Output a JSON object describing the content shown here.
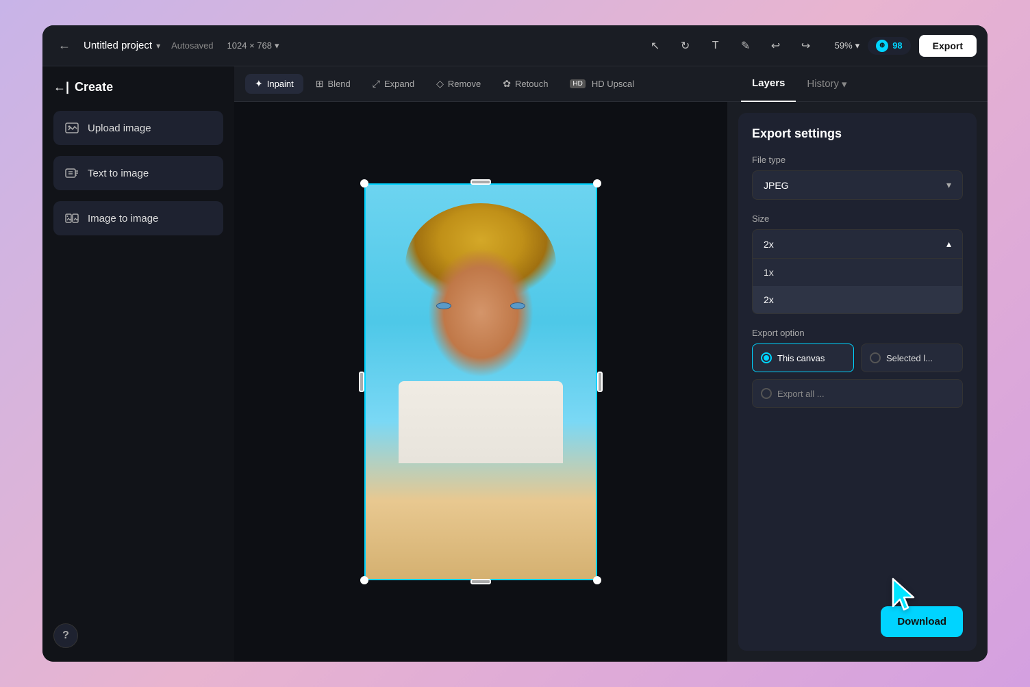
{
  "header": {
    "back_label": "←",
    "project_title": "Untitled project",
    "autosaved": "Autosaved",
    "dimensions": "1024 × 768",
    "zoom": "59%",
    "credits": "98",
    "export_label": "Export"
  },
  "sidebar": {
    "create_label": "Create",
    "buttons": [
      {
        "id": "upload-image",
        "label": "Upload image",
        "icon": "⬆"
      },
      {
        "id": "text-to-image",
        "label": "Text to image",
        "icon": "T"
      },
      {
        "id": "image-to-image",
        "label": "Image to image",
        "icon": "🖼"
      }
    ],
    "help_label": "?"
  },
  "toolbar": {
    "tabs": [
      {
        "id": "inpaint",
        "label": "Inpaint",
        "active": true
      },
      {
        "id": "blend",
        "label": "Blend",
        "active": false
      },
      {
        "id": "expand",
        "label": "Expand",
        "active": false
      },
      {
        "id": "remove",
        "label": "Remove",
        "active": false
      },
      {
        "id": "retouch",
        "label": "Retouch",
        "active": false
      },
      {
        "id": "upscal",
        "label": "HD Upscal",
        "active": false
      }
    ]
  },
  "right_panel": {
    "layers_label": "Layers",
    "history_label": "History",
    "export_settings": {
      "title": "Export settings",
      "file_type_label": "File type",
      "file_type_value": "JPEG",
      "size_label": "Size",
      "size_value": "2x",
      "size_options": [
        {
          "value": "1x",
          "label": "1x"
        },
        {
          "value": "2x",
          "label": "2x"
        }
      ],
      "export_option_label": "Export option",
      "export_options": [
        {
          "id": "this-canvas",
          "label": "This canvas",
          "active": true
        },
        {
          "id": "selected",
          "label": "Selected l...",
          "active": false
        }
      ],
      "export_all_label": "Export all ...",
      "download_label": "Download"
    }
  },
  "icons": {
    "back": "←",
    "chevron_down": "▾",
    "chevron_up": "▴",
    "select": "↖",
    "rotate": "↻",
    "text": "T",
    "pen": "✎",
    "undo": "↩",
    "redo": "↪",
    "sparkle": "✦",
    "wand": "⊞"
  }
}
